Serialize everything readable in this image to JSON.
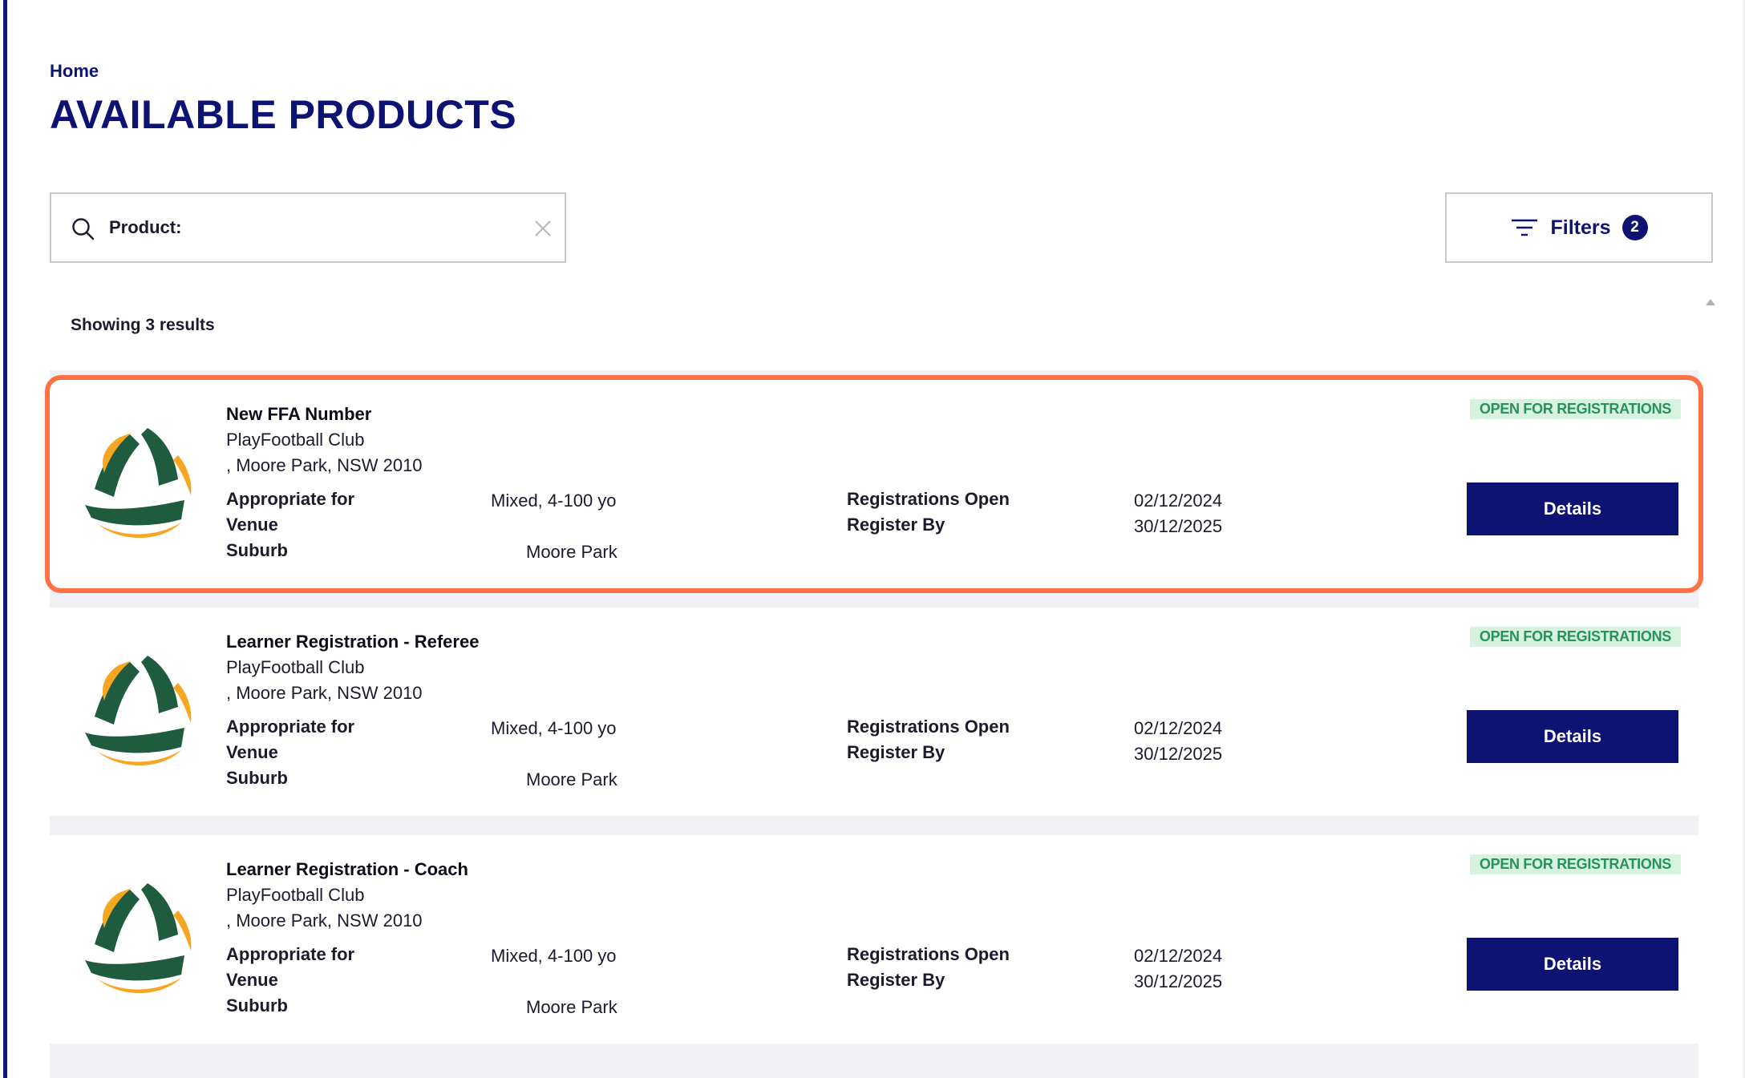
{
  "breadcrumb": "Home",
  "page_title": "AVAILABLE PRODUCTS",
  "search": {
    "placeholder": "Product:",
    "value": ""
  },
  "filters": {
    "label": "Filters",
    "count": "2"
  },
  "results_count": "Showing 3 results",
  "labels": {
    "appropriate_for": "Appropriate for",
    "venue": "Venue",
    "suburb": "Suburb",
    "registrations_open": "Registrations Open",
    "register_by": "Register By",
    "details": "Details"
  },
  "products": [
    {
      "title": "New FFA Number",
      "club": "PlayFootball Club",
      "address": ", Moore Park, NSW 2010",
      "appropriate_for": "Mixed, 4-100 yo",
      "suburb": "Moore Park",
      "registrations_open": "02/12/2024",
      "register_by": "30/12/2025",
      "status": "OPEN FOR REGISTRATIONS"
    },
    {
      "title": "Learner Registration - Referee",
      "club": "PlayFootball Club",
      "address": ", Moore Park, NSW 2010",
      "appropriate_for": "Mixed, 4-100 yo",
      "suburb": "Moore Park",
      "registrations_open": "02/12/2024",
      "register_by": "30/12/2025",
      "status": "OPEN FOR REGISTRATIONS"
    },
    {
      "title": "Learner Registration - Coach",
      "club": "PlayFootball Club",
      "address": ", Moore Park, NSW 2010",
      "appropriate_for": "Mixed, 4-100 yo",
      "suburb": "Moore Park",
      "registrations_open": "02/12/2024",
      "register_by": "30/12/2025",
      "status": "OPEN FOR REGISTRATIONS"
    }
  ],
  "colors": {
    "brand_navy": "#0c1373",
    "logo_green": "#1e5b3f",
    "logo_gold": "#f5a623",
    "status_green": "#27925a",
    "status_bg": "#d7f2e0",
    "selection_outline": "#ff7144"
  }
}
